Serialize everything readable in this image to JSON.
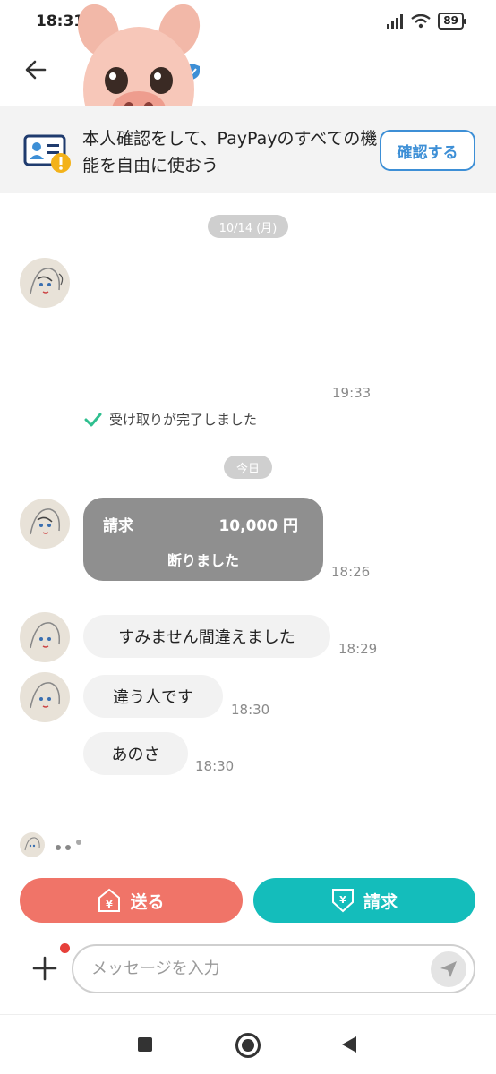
{
  "status_bar": {
    "time": "18:31",
    "battery": "89"
  },
  "banner": {
    "text": "本人確認をして、PayPayのすべての機能を自由に使おう",
    "button_label": "確認する"
  },
  "chat": {
    "date1": "10/14 (月)",
    "time1": "19:33",
    "received_text": "受け取りが完了しました",
    "date2": "今日",
    "request_card": {
      "label": "請求",
      "amount": "10,000 円",
      "status": "断りました",
      "time": "18:26"
    },
    "messages": [
      {
        "text": "すみません間違えました",
        "time": "18:29"
      },
      {
        "text": "違う人です",
        "time": "18:30"
      },
      {
        "text": "あのさ",
        "time": "18:30"
      }
    ]
  },
  "actions": {
    "send_label": "送る",
    "request_label": "請求"
  },
  "composer": {
    "placeholder": "メッセージを入力"
  },
  "colors": {
    "send": "#f07468",
    "request": "#14bdbb",
    "verify": "#3d8fd6"
  },
  "icons": [
    "back-arrow-icon",
    "verified-badge-icon",
    "id-card-warning-icon",
    "check-icon",
    "yen-house-icon",
    "yen-shield-icon",
    "plus-icon",
    "send-plane-icon"
  ]
}
